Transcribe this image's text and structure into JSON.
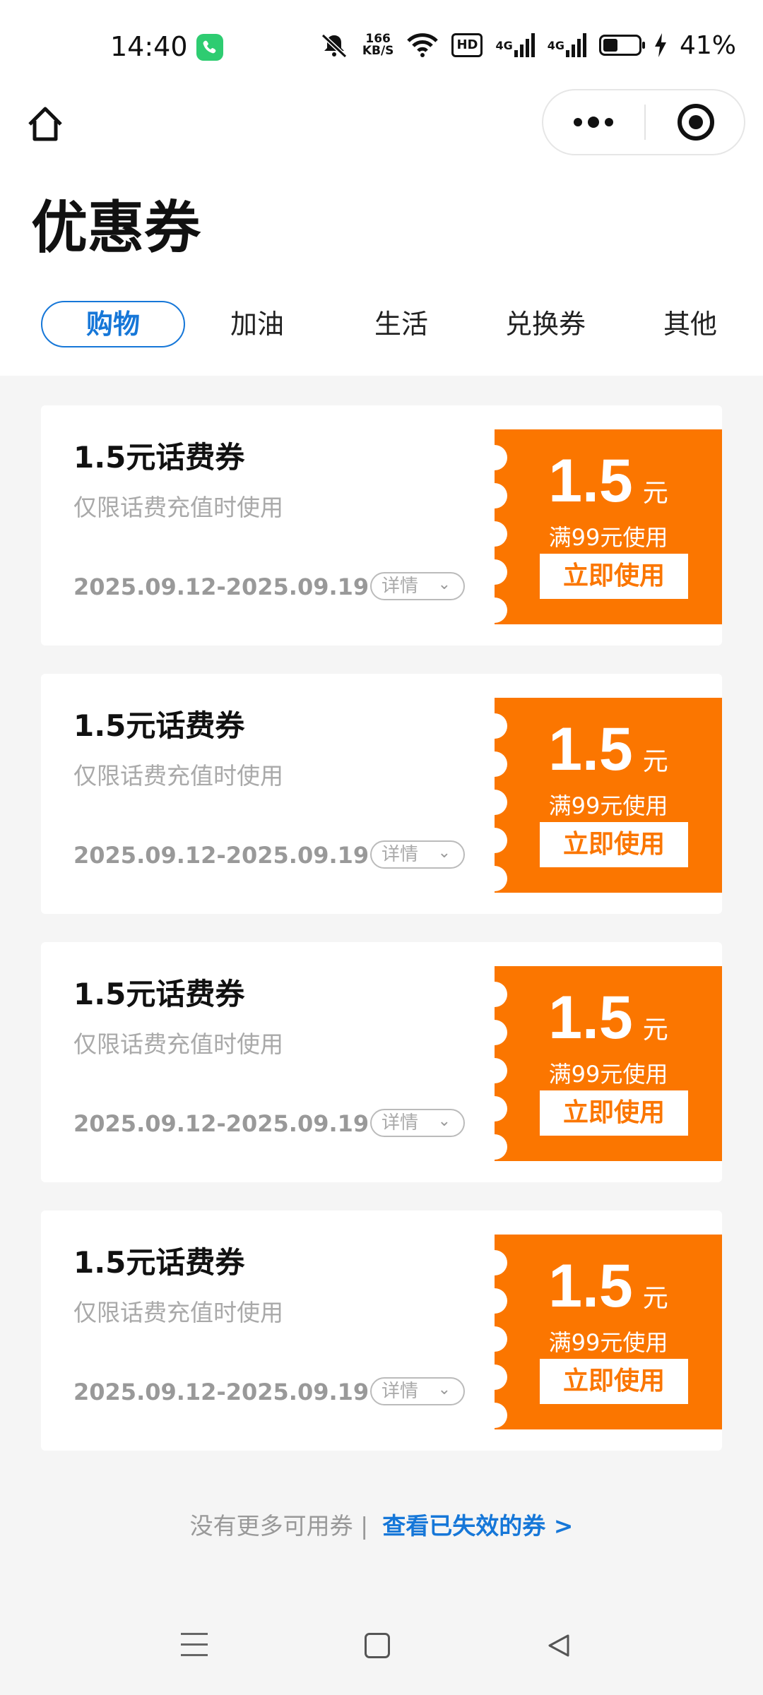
{
  "status_bar": {
    "time": "14:40",
    "net_speed_value": "166",
    "net_speed_unit": "KB/S",
    "hd_label": "HD",
    "signal1_label": "4G",
    "signal2_label": "4G",
    "battery_percent": 41,
    "battery_text": "41%",
    "icons": [
      "phone-call-icon",
      "mute-bell-icon",
      "wifi-icon",
      "hd-icon",
      "signal-icon",
      "battery-icon",
      "charging-icon"
    ]
  },
  "nav": {
    "home_icon": "home-icon",
    "more_icon": "more-dots-icon",
    "close_icon": "target-circle-icon"
  },
  "page": {
    "title": "优惠券"
  },
  "tabs": [
    {
      "label": "购物",
      "active": true
    },
    {
      "label": "加油",
      "active": false
    },
    {
      "label": "生活",
      "active": false
    },
    {
      "label": "兑换券",
      "active": false
    },
    {
      "label": "其他",
      "active": false
    }
  ],
  "coupons": [
    {
      "title": "1.5元话费券",
      "desc": "仅限话费充值时使用",
      "date": "2025.09.12-2025.09.19",
      "detail": "详情",
      "amount": "1.5",
      "unit": "元",
      "condition": "满99元使用",
      "use_label": "立即使用"
    },
    {
      "title": "1.5元话费券",
      "desc": "仅限话费充值时使用",
      "date": "2025.09.12-2025.09.19",
      "detail": "详情",
      "amount": "1.5",
      "unit": "元",
      "condition": "满99元使用",
      "use_label": "立即使用"
    },
    {
      "title": "1.5元话费券",
      "desc": "仅限话费充值时使用",
      "date": "2025.09.12-2025.09.19",
      "detail": "详情",
      "amount": "1.5",
      "unit": "元",
      "condition": "满99元使用",
      "use_label": "立即使用"
    },
    {
      "title": "1.5元话费券",
      "desc": "仅限话费充值时使用",
      "date": "2025.09.12-2025.09.19",
      "detail": "详情",
      "amount": "1.5",
      "unit": "元",
      "condition": "满99元使用",
      "use_label": "立即使用"
    }
  ],
  "footer": {
    "no_more": "没有更多可用券 |",
    "expired_link": "查看已失效的券 >"
  },
  "colors": {
    "accent": "#1677d8",
    "coupon_orange": "#fb7600",
    "muted_text": "#a9a9a9"
  }
}
